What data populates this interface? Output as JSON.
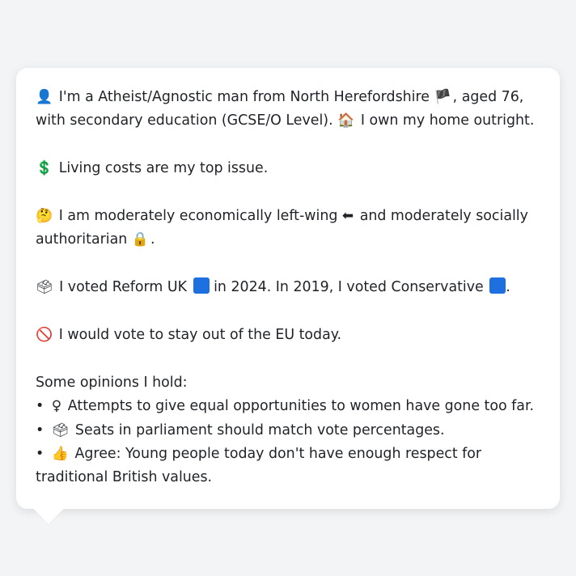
{
  "intro": {
    "icon": "👤",
    "text_a": "I'm a Atheist/Agnostic man from North Herefordshire",
    "flag": "🏴",
    "text_b": ", aged 76, with secondary education (GCSE/O Level).",
    "house_icon": "🏠",
    "text_c": "I own my home outright."
  },
  "issue": {
    "icon": "💲",
    "text": "Living costs are my top issue."
  },
  "ideology": {
    "icon": "🤔",
    "text_a": "I am moderately economically left-wing",
    "left_icon": "⬅",
    "text_b": "and moderately socially authoritarian",
    "lock_icon": "🔒",
    "text_c": "."
  },
  "votes": {
    "icon": "🗳",
    "text_a": "I voted Reform UK",
    "reform_color": "#1e6fe0",
    "text_b": "in 2024. In 2019, I voted Conservative",
    "conservative_color": "#1e6fe0",
    "text_c": "."
  },
  "eu": {
    "icon": "🚫",
    "text": "I would vote to stay out of the EU today."
  },
  "opinions": {
    "heading": "Some opinions I hold:",
    "items": [
      {
        "bullet": "•",
        "icon": "♀",
        "text": "Attempts to give equal opportunities to women have gone too far."
      },
      {
        "bullet": "•",
        "icon": "🗳",
        "text": "Seats in parliament should match vote percentages."
      },
      {
        "bullet": "•",
        "icon": "👍",
        "text": "Agree: Young people today don't have enough respect for traditional British values."
      }
    ]
  }
}
